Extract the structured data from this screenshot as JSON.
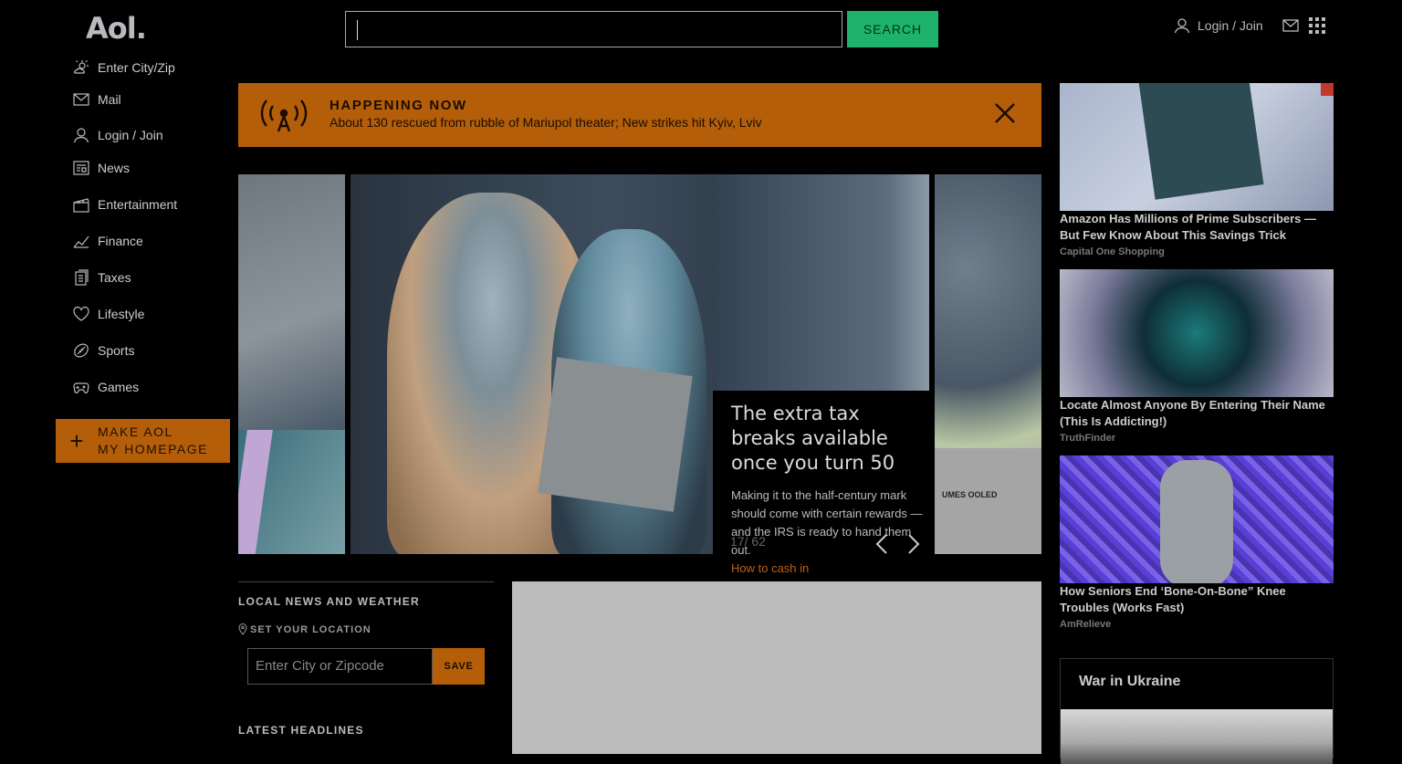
{
  "header": {
    "logo": "Aol.",
    "search_button": "SEARCH",
    "login": "Login / Join"
  },
  "sidebar": {
    "items": [
      {
        "label": "Enter City/Zip",
        "icon": "weather-icon"
      },
      {
        "label": "Mail",
        "icon": "mail-icon"
      },
      {
        "label": "Login / Join",
        "icon": "user-icon"
      },
      {
        "label": "News",
        "icon": "news-icon"
      },
      {
        "label": "Entertainment",
        "icon": "clapperboard-icon"
      },
      {
        "label": "Finance",
        "icon": "chart-icon"
      },
      {
        "label": "Taxes",
        "icon": "document-icon"
      },
      {
        "label": "Lifestyle",
        "icon": "heart-icon"
      },
      {
        "label": "Sports",
        "icon": "ball-icon"
      },
      {
        "label": "Games",
        "icon": "gamepad-icon"
      }
    ],
    "homepage_line1": "MAKE AOL",
    "homepage_line2": "MY HOMEPAGE"
  },
  "banner": {
    "kicker": "HAPPENING NOW",
    "text": "About 130 rescued from rubble of Mariupol theater; New strikes hit Kyiv, Lviv"
  },
  "carousel": {
    "title": "The extra tax breaks available once you turn 50",
    "description": "Making it to the half-century mark should come with certain rewards — and the IRS is ready to hand them out.",
    "cta": "How to cash in",
    "counter": "17/ 62",
    "right_slide_shirt_text": "UMES   OOLED"
  },
  "local": {
    "title": "LOCAL NEWS AND WEATHER",
    "set_location": "SET YOUR LOCATION",
    "city_placeholder": "Enter City or Zipcode",
    "save": "SAVE",
    "latest": "LATEST HEADLINES"
  },
  "ads": [
    {
      "title": "Amazon Has Millions of Prime Subscribers — But Few Know About This Savings Trick",
      "source": "Capital One Shopping"
    },
    {
      "title": "Locate Almost Anyone By Entering Their Name (This Is Addicting!)",
      "source": "TruthFinder"
    },
    {
      "title": "How Seniors End ‘Bone-On-Bone” Knee Troubles (Works Fast)",
      "source": "AmRelieve"
    }
  ],
  "ukraine": {
    "title": "War in Ukraine"
  },
  "colors": {
    "accent_orange": "#b45e0a",
    "search_green": "#1db36a"
  }
}
